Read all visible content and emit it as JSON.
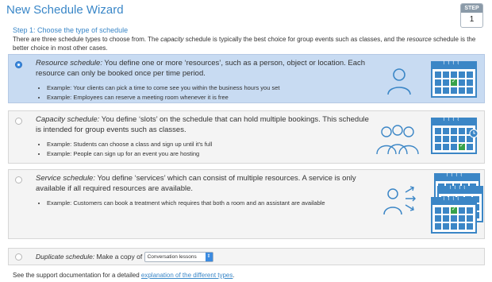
{
  "title": "New Schedule Wizard",
  "step": {
    "label": "STEP",
    "number": "1"
  },
  "step_title": "Step 1: Choose the type of schedule",
  "intro": {
    "part1": "There are three schedule types to choose from. The ",
    "em1": "capacity",
    "part2": " schedule is typically the best choice for group events such as classes, and the ",
    "em2": "resource",
    "part3": " schedule is the better choice in most other cases."
  },
  "options": [
    {
      "name": "Resource schedule:",
      "desc": " You define one or more ‘resources’, such as a person, object or location. Each resource can only be booked once per time period.",
      "examples": [
        "Example: Your clients can pick a time to come see you within the business hours you set",
        "Example: Employees can reserve a meeting room whenever it is free"
      ],
      "selected": true,
      "icon": "single-person-icon"
    },
    {
      "name": "Capacity schedule:",
      "desc": " You define ‘slots’ on the schedule that can hold multiple bookings. This schedule is intended for group events such as classes.",
      "examples": [
        "Example: Students can choose a class and sign up until it’s full",
        "Example: People can sign up for an event you are hosting"
      ],
      "selected": false,
      "icon": "group-people-icon"
    },
    {
      "name": "Service schedule:",
      "desc": " You define ‘services’ which can consist of multiple resources. A service is only available if all required resources are available.",
      "examples": [
        "Example: Customers can book a treatment which requires that both a room and an assistant are available"
      ],
      "selected": false,
      "icon": "person-arrows-icon"
    }
  ],
  "duplicate": {
    "name": "Duplicate schedule:",
    "text": " Make a copy of ",
    "select_value": "Conversation lessons"
  },
  "footer": {
    "text": "See the support documentation for a detailed ",
    "link": "explanation of the different types",
    "end": "."
  },
  "colors": {
    "accent": "#3a87c8",
    "selected_bg": "#c8dbf2",
    "check_green": "#36a24a"
  }
}
